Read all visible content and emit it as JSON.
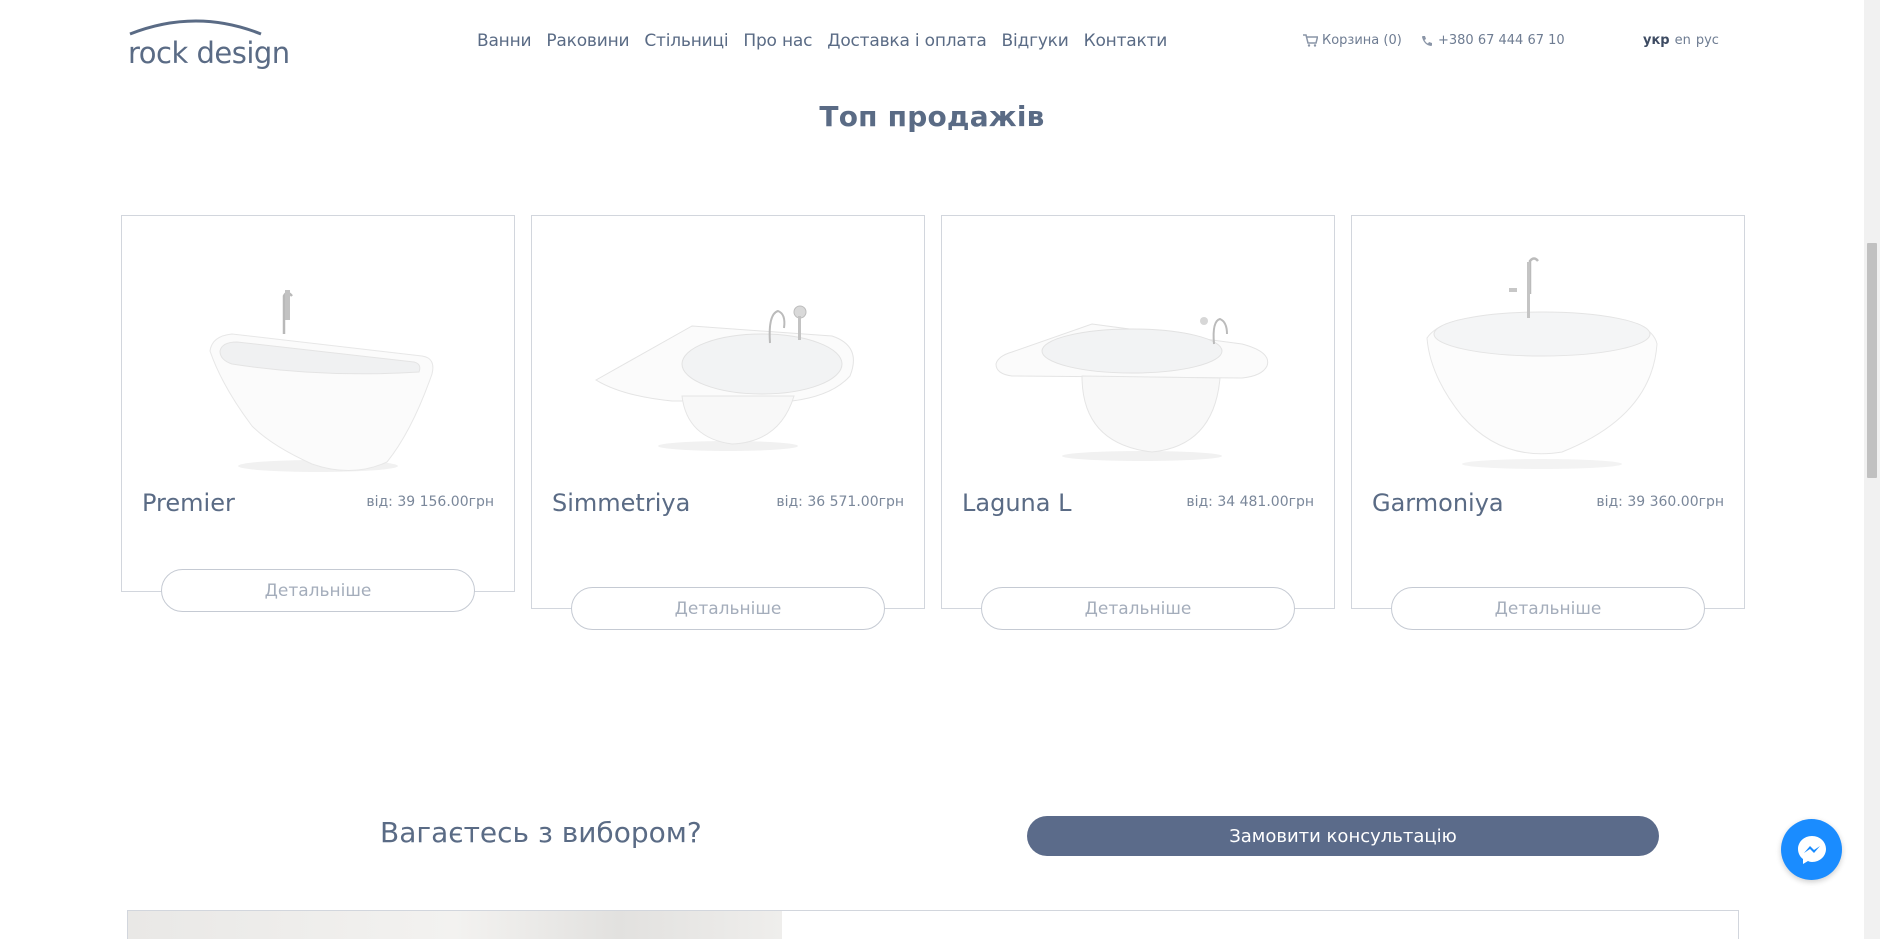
{
  "header": {
    "logo_text": "rock design",
    "nav": [
      "Ванни",
      "Раковини",
      "Стільниці",
      "Про нас",
      "Доставка і оплата",
      "Відгуки",
      "Контакти"
    ],
    "cart_label": "Корзина (0)",
    "phone": "+380 67 444 67 10",
    "languages": [
      "укр",
      "en",
      "рус"
    ],
    "active_language": "укр"
  },
  "section_title": "Топ продажів",
  "products": [
    {
      "name": "Premier",
      "price": "від: 39 156.00грн",
      "button": "Детальніше"
    },
    {
      "name": "Simmetriya",
      "price": "від: 36 571.00грн",
      "button": "Детальніше"
    },
    {
      "name": "Laguna L",
      "price": "від: 34 481.00грн",
      "button": "Детальніше"
    },
    {
      "name": "Garmoniya",
      "price": "від: 39 360.00грн",
      "button": "Детальніше"
    }
  ],
  "consult": {
    "question": "Вагаєтесь з вибором?",
    "button": "Замовити консультацію"
  },
  "colors": {
    "brand": "#5b6b8a",
    "text": "#5a6b85",
    "messenger": "#1a8cff"
  }
}
